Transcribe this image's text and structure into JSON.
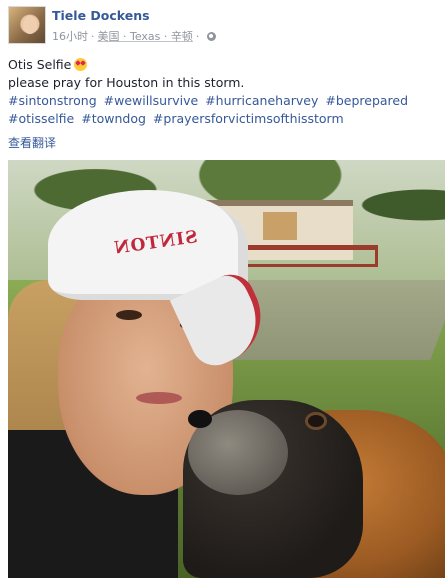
{
  "post": {
    "author": "Tiele Dockens",
    "time": "16小时",
    "location": "美国 · Texas · 辛顿",
    "privacy_icon": "globe-icon",
    "line1": "Otis Selfie",
    "line1_emoji": "heart-eyes-emoji",
    "line2": "please pray for Houston in this storm.",
    "hashtags": [
      "#sintonstrong",
      "#wewillsurvive",
      "#hurricaneharvey",
      "#beprepared",
      "#otisselfie",
      "#towndog",
      "#prayersforvictimsofthisstorm"
    ],
    "translate_link": "查看翻译"
  },
  "photo": {
    "cap_text": "SINTON"
  },
  "colors": {
    "link": "#365899",
    "meta": "#90949c",
    "text": "#1d2129"
  }
}
